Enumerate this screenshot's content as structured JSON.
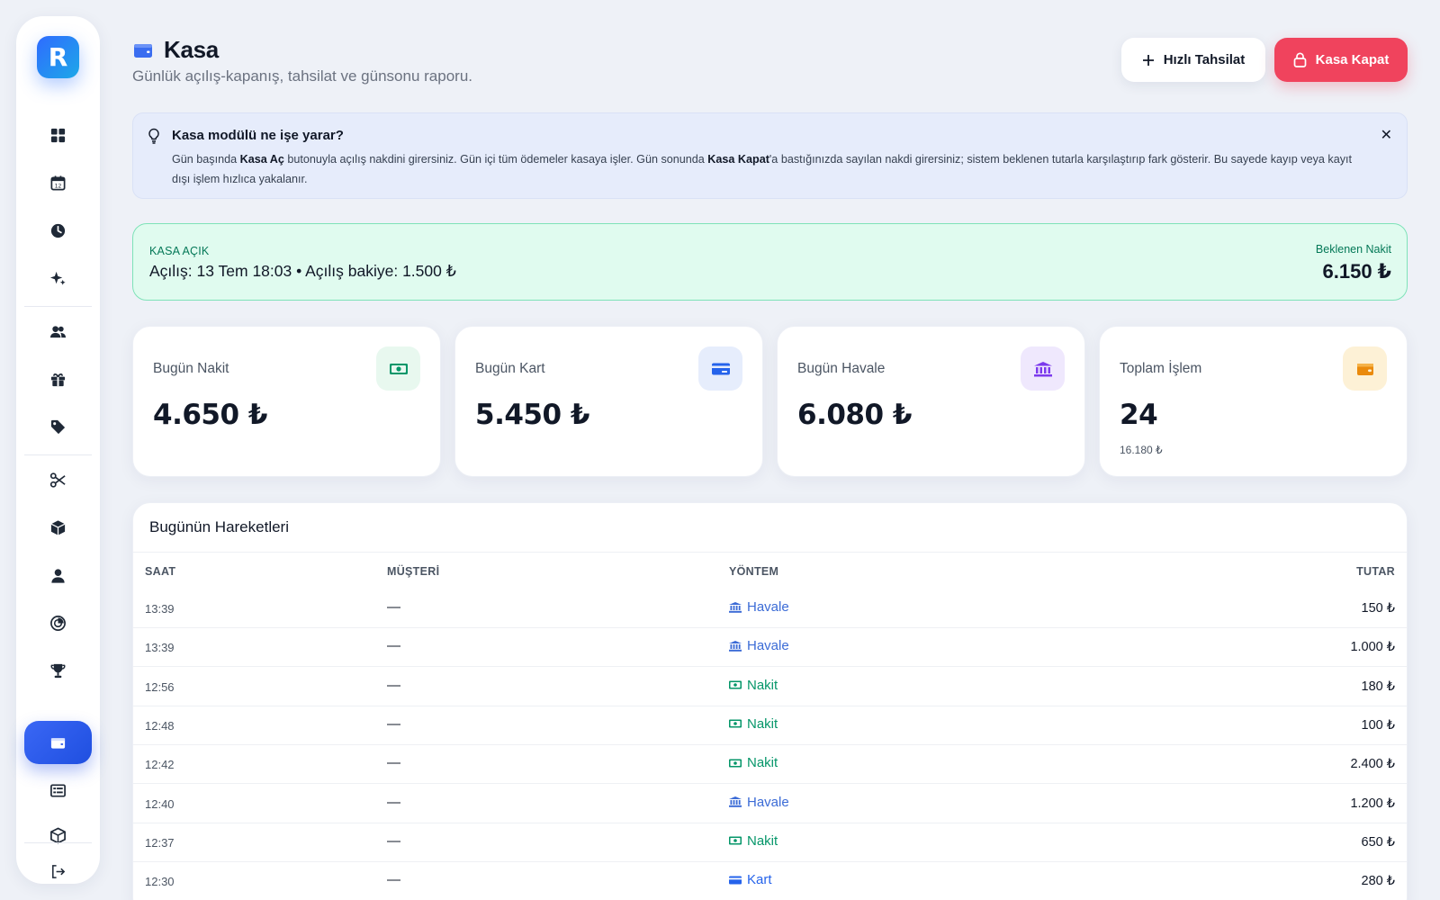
{
  "app": {
    "logo_letter": "R"
  },
  "sidebar": {
    "items": [
      {
        "icon": "grid-icon"
      },
      {
        "icon": "calendar-icon",
        "badge": "12"
      },
      {
        "icon": "clock-icon"
      },
      {
        "icon": "sparkle-icon"
      },
      {
        "icon": "users-icon"
      },
      {
        "icon": "gift-icon"
      },
      {
        "icon": "tag-icon"
      },
      {
        "icon": "scissors-icon"
      },
      {
        "icon": "box-icon"
      },
      {
        "icon": "user-icon"
      },
      {
        "icon": "chart-pie-icon"
      },
      {
        "icon": "trophy-icon"
      },
      {
        "icon": "wallet-icon",
        "active": true
      },
      {
        "icon": "list-icon"
      },
      {
        "icon": "package-icon"
      }
    ],
    "logout_icon": "logout-icon"
  },
  "header": {
    "title": "Kasa",
    "subtitle": "Günlük açılış-kapanış, tahsilat ve günsonu raporu.",
    "quick_btn": "Hızlı Tahsilat",
    "close_btn": "Kasa Kapat"
  },
  "info": {
    "title": "Kasa modülü ne işe yarar?",
    "t1": "Gün başında ",
    "b1": "Kasa Aç",
    "t2": " butonuyla açılış nakdini girersiniz. Gün içi tüm ödemeler kasaya işler. Gün sonunda ",
    "b2": "Kasa Kapat",
    "t3": "'a bastığınızda sayılan nakdi girersiniz; sistem beklenen tutarla karşılaştırıp fark gösterir. Bu sayede kayıp veya kayıt dışı işlem hızlıca yakalanır."
  },
  "kasa": {
    "status": "KASA AÇIK",
    "opening": "Açılış: 13 Tem 18:03 • Açılış bakiye: 1.500 ₺",
    "expected_label": "Beklenen Nakit",
    "expected_value": "6.150 ₺"
  },
  "stats": [
    {
      "label": "Bugün Nakit",
      "value": "4.650 ₺",
      "icon": "cash-icon",
      "color": "#059669",
      "bg": "#e8f8ef"
    },
    {
      "label": "Bugün Kart",
      "value": "5.450 ₺",
      "icon": "card-icon",
      "color": "#2563eb",
      "bg": "#e6edfc"
    },
    {
      "label": "Bugün Havale",
      "value": "6.080 ₺",
      "icon": "bank-icon",
      "color": "#7c3aed",
      "bg": "#efe8fd"
    },
    {
      "label": "Toplam İşlem",
      "value": "24",
      "sub": "16.180 ₺",
      "icon": "wallet-icon",
      "color": "#ea8a0c",
      "bg": "#fdf1d6"
    }
  ],
  "table": {
    "title": "Bugünün Hareketleri",
    "headers": {
      "time": "SAAT",
      "customer": "MÜŞTERİ",
      "method": "YÖNTEM",
      "amount": "TUTAR"
    },
    "rows": [
      {
        "time": "13:39",
        "customer": "—",
        "method": "Havale",
        "amount": "150 ₺"
      },
      {
        "time": "13:39",
        "customer": "—",
        "method": "Havale",
        "amount": "1.000 ₺"
      },
      {
        "time": "12:56",
        "customer": "—",
        "method": "Nakit",
        "amount": "180 ₺"
      },
      {
        "time": "12:48",
        "customer": "—",
        "method": "Nakit",
        "amount": "100 ₺"
      },
      {
        "time": "12:42",
        "customer": "—",
        "method": "Nakit",
        "amount": "2.400 ₺"
      },
      {
        "time": "12:40",
        "customer": "—",
        "method": "Havale",
        "amount": "1.200 ₺"
      },
      {
        "time": "12:37",
        "customer": "—",
        "method": "Nakit",
        "amount": "650 ₺"
      },
      {
        "time": "12:30",
        "customer": "—",
        "method": "Kart",
        "amount": "280 ₺"
      }
    ]
  }
}
